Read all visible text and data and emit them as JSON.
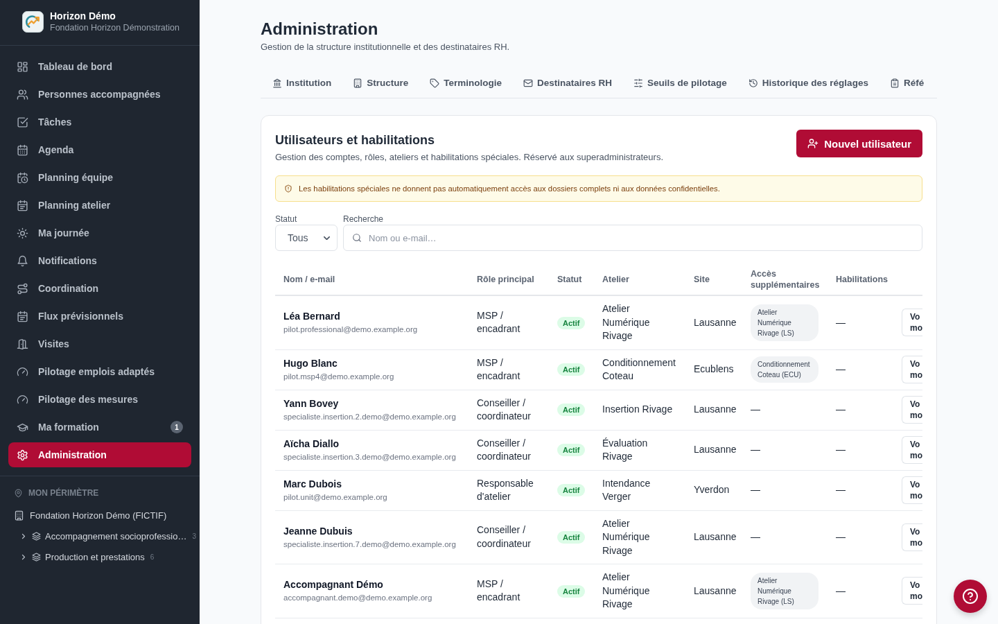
{
  "brand": {
    "name": "Horizon Démo",
    "organization": "Fondation Horizon Démonstration"
  },
  "sidebar": {
    "items": [
      {
        "label": "Tableau de bord",
        "selected": false
      },
      {
        "label": "Personnes accompagnées",
        "selected": false
      },
      {
        "label": "Tâches",
        "selected": false
      },
      {
        "label": "Agenda",
        "selected": false
      },
      {
        "label": "Planning équipe",
        "selected": false
      },
      {
        "label": "Planning atelier",
        "selected": false
      },
      {
        "label": "Ma journée",
        "selected": false
      },
      {
        "label": "Notifications",
        "selected": false
      },
      {
        "label": "Coordination",
        "selected": false
      },
      {
        "label": "Flux prévisionnels",
        "selected": false
      },
      {
        "label": "Visites",
        "selected": false
      },
      {
        "label": "Pilotage emplois adaptés",
        "selected": false
      },
      {
        "label": "Pilotage des mesures",
        "selected": false
      },
      {
        "label": "Ma formation",
        "selected": false,
        "badge": "1"
      },
      {
        "label": "Administration",
        "selected": true
      }
    ]
  },
  "perimeter": {
    "heading": "MON PÉRIMÈTRE",
    "organization": {
      "label": "Fondation Horizon Démo (FICTIF)",
      "children": [
        {
          "label": "Accompagnement socioprofessio…",
          "count": "3",
          "expanded": false
        },
        {
          "label": "Production et prestations",
          "count": "6",
          "expanded": false
        }
      ]
    }
  },
  "page": {
    "title": "Administration",
    "subtitle": "Gestion de la structure institutionnelle et des destinataires RH."
  },
  "tabs": [
    {
      "label": "Institution",
      "selected": false
    },
    {
      "label": "Structure",
      "selected": false
    },
    {
      "label": "Terminologie",
      "selected": false
    },
    {
      "label": "Destinataires RH",
      "selected": false
    },
    {
      "label": "Seuils de pilotage",
      "selected": false
    },
    {
      "label": "Historique des réglages",
      "selected": false
    },
    {
      "label": "Réfé",
      "selected": false
    }
  ],
  "users_panel": {
    "title": "Utilisateurs et habilitations",
    "description": "Gestion des comptes, rôles, ateliers et habilitations spéciales. Réservé aux superadministrateurs.",
    "new_button": "Nouvel utilisateur",
    "notice": "Les habilitations spéciales ne donnent pas automatiquement accès aux dossiers complets ni aux données confidentielles.",
    "filters": {
      "status": {
        "label": "Statut",
        "value": "Tous"
      },
      "search": {
        "label": "Recherche",
        "placeholder": "Nom ou e-mail…"
      }
    },
    "table": {
      "columns": [
        "Nom / e-mail",
        "Rôle principal",
        "Statut",
        "Atelier",
        "Site",
        "Accès supplémentaires",
        "Habilitations"
      ],
      "rows": [
        {
          "name": "Léa Bernard",
          "email": "pilot.professional@demo.example.org",
          "role": "MSP / encadrant",
          "status": "Actif",
          "workshop": "Atelier Numérique Rivage",
          "site": "Lausanne",
          "access": {
            "kind": "tag",
            "text": "Atelier Numérique Rivage (LS)"
          },
          "permissions": "—",
          "action": "Vo mo"
        },
        {
          "name": "Hugo Blanc",
          "email": "pilot.msp4@demo.example.org",
          "role": "MSP / encadrant",
          "status": "Actif",
          "workshop": "Conditionnement Coteau",
          "site": "Ecublens",
          "access": {
            "kind": "tag",
            "text": "Conditionnement Coteau (ECU)"
          },
          "permissions": "—",
          "action": "Vo mo"
        },
        {
          "name": "Yann Bovey",
          "email": "specialiste.insertion.2.demo@demo.example.org",
          "role": "Conseiller / coordinateur",
          "status": "Actif",
          "workshop": "Insertion Rivage",
          "site": "Lausanne",
          "access": {
            "kind": "none",
            "text": "—"
          },
          "permissions": "—",
          "action": "Vo mo"
        },
        {
          "name": "Aïcha Diallo",
          "email": "specialiste.insertion.3.demo@demo.example.org",
          "role": "Conseiller / coordinateur",
          "status": "Actif",
          "workshop": "Évaluation Rivage",
          "site": "Lausanne",
          "access": {
            "kind": "none",
            "text": "—"
          },
          "permissions": "—",
          "action": "Vo mo"
        },
        {
          "name": "Marc Dubois",
          "email": "pilot.unit@demo.example.org",
          "role": "Responsable d'atelier",
          "status": "Actif",
          "workshop": "Intendance Verger",
          "site": "Yverdon",
          "access": {
            "kind": "none",
            "text": "—"
          },
          "permissions": "—",
          "action": "Vo mo"
        },
        {
          "name": "Jeanne Dubuis",
          "email": "specialiste.insertion.7.demo@demo.example.org",
          "role": "Conseiller / coordinateur",
          "status": "Actif",
          "workshop": "Atelier Numérique Rivage",
          "site": "Lausanne",
          "access": {
            "kind": "none",
            "text": "—"
          },
          "permissions": "—",
          "action": "Vo mo"
        },
        {
          "name": "Accompagnant Démo",
          "email": "accompagnant.demo@demo.example.org",
          "role": "MSP / encadrant",
          "status": "Actif",
          "workshop": "Atelier Numérique Rivage",
          "site": "Lausanne",
          "access": {
            "kind": "tag",
            "text": "Atelier Numérique Rivage (LS)"
          },
          "permissions": "—",
          "action": "Vo mo"
        }
      ]
    }
  }
}
